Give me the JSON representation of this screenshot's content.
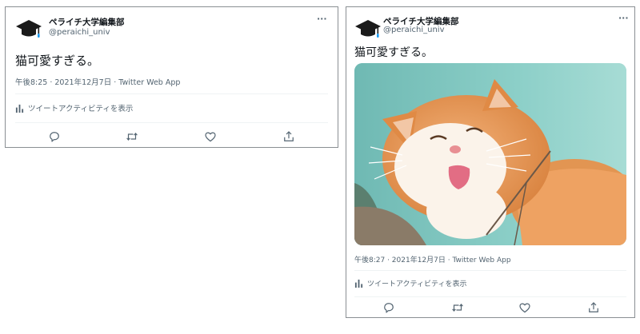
{
  "tweets": [
    {
      "account": {
        "name": "ペライチ大学編集部",
        "handle": "@peraichi_univ"
      },
      "more_label": "···",
      "text": "猫可愛すぎる。",
      "meta": "午後8:25 · 2021年12月7日 · Twitter Web App",
      "activity_label": "ツイートアクティビティを表示",
      "has_image": false
    },
    {
      "account": {
        "name": "ペライチ大学編集部",
        "handle": "@peraichi_univ"
      },
      "more_label": "···",
      "text": "猫可愛すぎる。",
      "meta": "午後8:27 · 2021年12月7日 · Twitter Web App",
      "activity_label": "ツイートアクティビティを表示",
      "has_image": true,
      "image_subject": "orange-and-white cat"
    }
  ],
  "icons": {
    "avatar": "graduation-cap-icon",
    "activity": "bar-chart-icon",
    "reply": "speech-bubble-icon",
    "retweet": "retweet-icon",
    "like": "heart-icon",
    "share": "share-upload-icon"
  },
  "colors": {
    "text": "#0f1419",
    "secondary": "#536471",
    "divider": "#eff3f4",
    "border": "#8a8f93",
    "avatar_accent": "#1d9bf0"
  }
}
